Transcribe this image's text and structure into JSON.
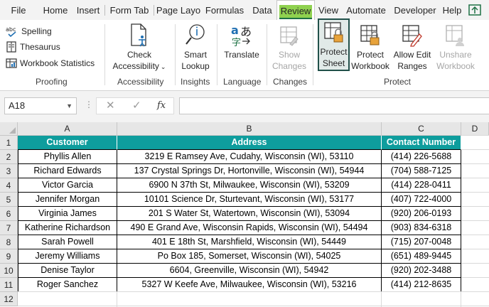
{
  "menu": {
    "tabs": [
      "File",
      "Home",
      "Insert",
      "Form Tab",
      "Page Layo",
      "Formulas",
      "Data",
      "Review",
      "View",
      "Automate",
      "Developer",
      "Help"
    ],
    "active_tab": "Review"
  },
  "ribbon": {
    "proofing": {
      "spelling": "Spelling",
      "thesaurus": "Thesaurus",
      "workbook_statistics": "Workbook Statistics",
      "label": "Proofing"
    },
    "accessibility": {
      "check_line1": "Check",
      "check_line2": "Accessibility",
      "label": "Accessibility"
    },
    "insights": {
      "smart_line1": "Smart",
      "smart_line2": "Lookup",
      "label": "Insights"
    },
    "language": {
      "translate": "Translate",
      "label": "Language"
    },
    "changes": {
      "show_line1": "Show",
      "show_line2": "Changes",
      "label": "Changes"
    },
    "protect": {
      "sheet_line1": "Protect",
      "sheet_line2": "Sheet",
      "workbook_line1": "Protect",
      "workbook_line2": "Workbook",
      "allow_line1": "Allow Edit",
      "allow_line2": "Ranges",
      "unshare_line1": "Unshare",
      "unshare_line2": "Workbook",
      "label": "Protect"
    }
  },
  "formula_bar": {
    "name_box": "A18",
    "fx_symbol": "fx",
    "cancel_symbol": "✕",
    "enter_symbol": "✓",
    "value": ""
  },
  "sheet": {
    "columns": [
      "A",
      "B",
      "C",
      "D"
    ],
    "rows": [
      "1",
      "2",
      "3",
      "4",
      "5",
      "6",
      "7",
      "8",
      "9",
      "10",
      "11",
      "12"
    ],
    "headers": [
      "Customer",
      "Address",
      "Contact Number"
    ],
    "data": [
      [
        "Phyllis Allen",
        "3219 E Ramsey Ave, Cudahy, Wisconsin (WI), 53110",
        "(414) 226-5688"
      ],
      [
        "Richard Edwards",
        "137 Crystal Springs Dr, Hortonville, Wisconsin (WI), 54944",
        "(704) 588-7125"
      ],
      [
        "Victor Garcia",
        "6900 N 37th St, Milwaukee, Wisconsin (WI), 53209",
        "(414) 228-0411"
      ],
      [
        "Jennifer Morgan",
        "10101 Science Dr, Sturtevant, Wisconsin (WI), 53177",
        "(407) 722-4000"
      ],
      [
        "Virginia James",
        "201 S Water St, Watertown, Wisconsin (WI), 53094",
        "(920) 206-0193"
      ],
      [
        "Katherine Richardson",
        "490 E Grand Ave, Wisconsin Rapids, Wisconsin (WI), 54494",
        "(903) 834-6318"
      ],
      [
        "Sarah Powell",
        "401 E 18th St, Marshfield, Wisconsin (WI), 54449",
        "(715) 207-0048"
      ],
      [
        "Jeremy Williams",
        "Po Box 185, Somerset, Wisconsin (WI), 54025",
        "(651) 489-9445"
      ],
      [
        "Denise Taylor",
        "6604, Greenville, Wisconsin (WI), 54942",
        "(920) 202-3488"
      ],
      [
        "Roger Sanchez",
        "5327 W Keefe Ave, Milwaukee, Wisconsin (WI), 53216",
        "(414) 212-8635"
      ]
    ]
  },
  "colors": {
    "header_fill": "#0e9d9d",
    "review_highlight": "#8fd14f",
    "excel_green": "#1e7145"
  }
}
